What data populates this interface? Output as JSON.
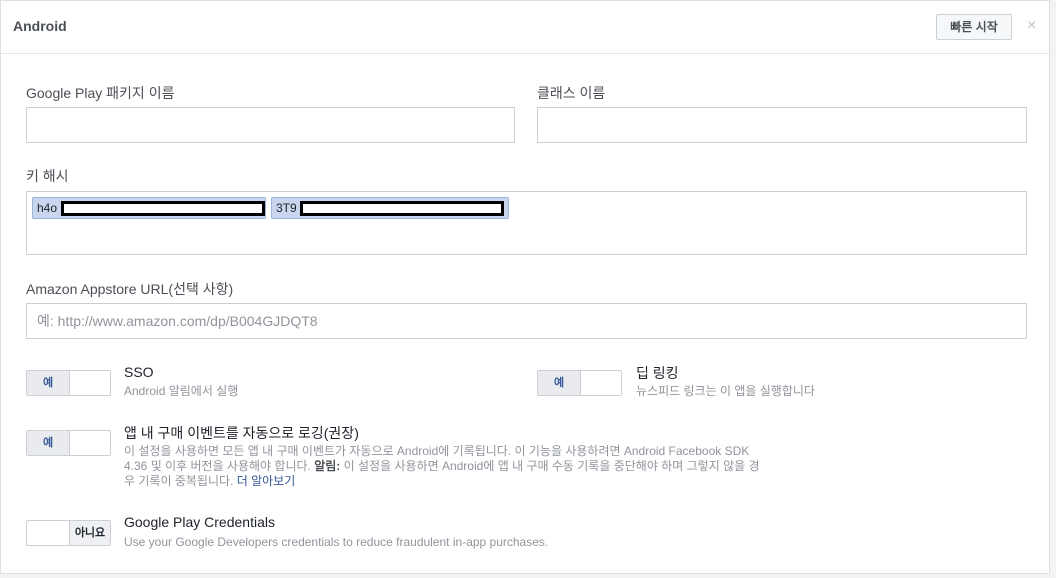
{
  "header": {
    "title": "Android",
    "quick_start_label": "빠른 시작",
    "close_label": "×"
  },
  "fields": {
    "package_label": "Google Play 패키지 이름",
    "package_value": "",
    "class_label": "클래스 이름",
    "class_value": "",
    "key_hash_label": "키 해시",
    "key_hashes": [
      "h4o",
      "3T9"
    ],
    "amazon_label": "Amazon Appstore URL(선택 사항)",
    "amazon_placeholder": "예: http://www.amazon.com/dp/B004GJDQT8"
  },
  "options": {
    "sso": {
      "title": "SSO",
      "desc": "Android 알림에서 실행",
      "state": "예"
    },
    "deep_linking": {
      "title": "딥 링킹",
      "desc": "뉴스피드 링크는 이 앱을 실행합니다",
      "state": "예"
    },
    "iap_logging": {
      "title": "앱 내 구매 이벤트를 자동으로 로깅(권장)",
      "desc_part1": "이 설정을 사용하면 모든 앱 내 구매 이벤트가 자동으로 Android에 기록됩니다. 이 기능을 사용하려면 Android Facebook SDK 4.36 및 이후 버전을 사용해야 합니다. ",
      "desc_bold": "알림:",
      "desc_part2": " 이 설정을 사용하면 Android에 앱 내 구매 수동 기록을 중단해야 하며 그렇지 않을 경우 기록이 중복됩니다. ",
      "learn_more": "더 알아보기",
      "state": "예"
    },
    "play_credentials": {
      "title": "Google Play Credentials",
      "desc": "Use your Google Developers credentials to reduce fraudulent in-app purchases.",
      "state": "아니요"
    }
  }
}
